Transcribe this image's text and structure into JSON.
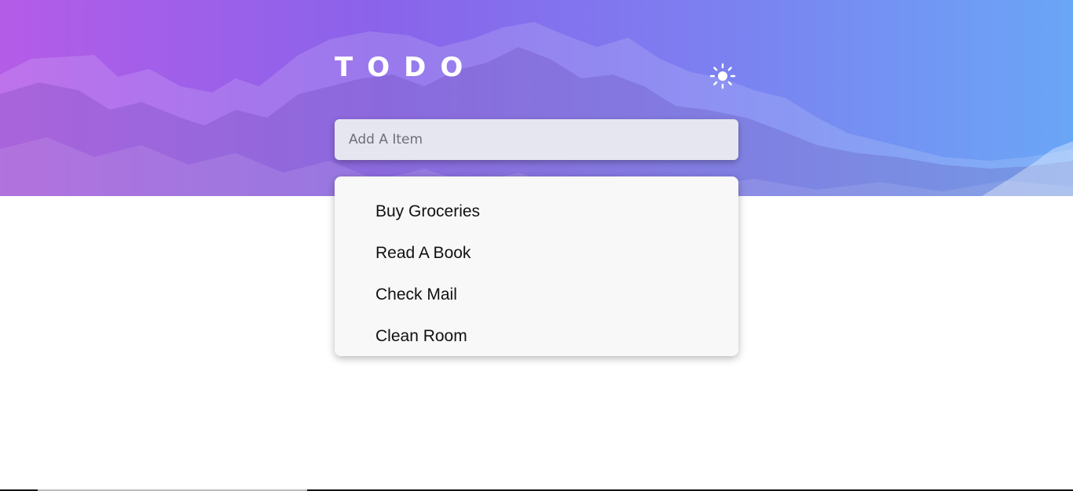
{
  "header": {
    "title": "TODO",
    "theme_toggle_icon": "sun-icon"
  },
  "add_item": {
    "placeholder": "Add A Item",
    "value": ""
  },
  "todos": [
    {
      "label": "Buy Groceries"
    },
    {
      "label": "Read A Book"
    },
    {
      "label": "Check Mail"
    },
    {
      "label": "Clean Room"
    }
  ],
  "colors": {
    "gradient_start": "#b45ce8",
    "gradient_end": "#6aa6f6",
    "input_background": "#e6e6f0",
    "list_background": "#f8f8f8"
  }
}
